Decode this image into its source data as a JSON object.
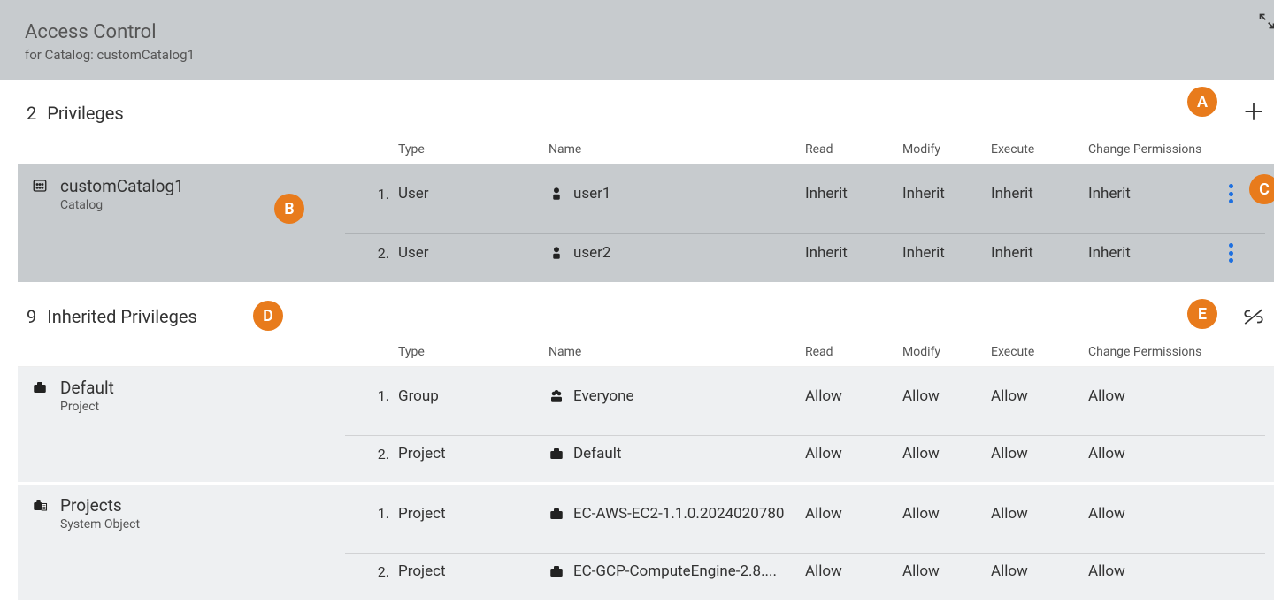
{
  "header": {
    "title": "Access Control",
    "subtitle": "for Catalog: customCatalog1"
  },
  "callouts": {
    "a": "A",
    "b": "B",
    "c": "C",
    "d": "D",
    "e": "E"
  },
  "sections": {
    "privileges": {
      "count": "2",
      "title": "Privileges",
      "columns": {
        "type": "Type",
        "name": "Name",
        "read": "Read",
        "modify": "Modify",
        "execute": "Execute",
        "change_permissions": "Change Permissions"
      },
      "groups": [
        {
          "icon": "catalog",
          "name": "customCatalog1",
          "subtype": "Catalog",
          "rows": [
            {
              "idx": "1.",
              "type": "User",
              "icon": "user",
              "name": "user1",
              "read": "Inherit",
              "modify": "Inherit",
              "execute": "Inherit",
              "cp": "Inherit",
              "kebab": true
            },
            {
              "idx": "2.",
              "type": "User",
              "icon": "user",
              "name": "user2",
              "read": "Inherit",
              "modify": "Inherit",
              "execute": "Inherit",
              "cp": "Inherit",
              "kebab": true
            }
          ]
        }
      ]
    },
    "inherited": {
      "count": "9",
      "title": "Inherited Privileges",
      "columns": {
        "type": "Type",
        "name": "Name",
        "read": "Read",
        "modify": "Modify",
        "execute": "Execute",
        "change_permissions": "Change Permissions"
      },
      "groups": [
        {
          "icon": "project",
          "name": "Default",
          "subtype": "Project",
          "rows": [
            {
              "idx": "1.",
              "type": "Group",
              "icon": "group",
              "name": "Everyone",
              "read": "Allow",
              "modify": "Allow",
              "execute": "Allow",
              "cp": "Allow"
            },
            {
              "idx": "2.",
              "type": "Project",
              "icon": "project",
              "name": "Default",
              "read": "Allow",
              "modify": "Allow",
              "execute": "Allow",
              "cp": "Allow"
            }
          ]
        },
        {
          "icon": "system",
          "name": "Projects",
          "subtype": "System Object",
          "rows": [
            {
              "idx": "1.",
              "type": "Project",
              "icon": "project",
              "name": "EC-AWS-EC2-1.1.0.2024020780",
              "read": "Allow",
              "modify": "Allow",
              "execute": "Allow",
              "cp": "Allow"
            },
            {
              "idx": "2.",
              "type": "Project",
              "icon": "project",
              "name": "EC-GCP-ComputeEngine-2.8....",
              "read": "Allow",
              "modify": "Allow",
              "execute": "Allow",
              "cp": "Allow"
            }
          ]
        }
      ]
    }
  }
}
